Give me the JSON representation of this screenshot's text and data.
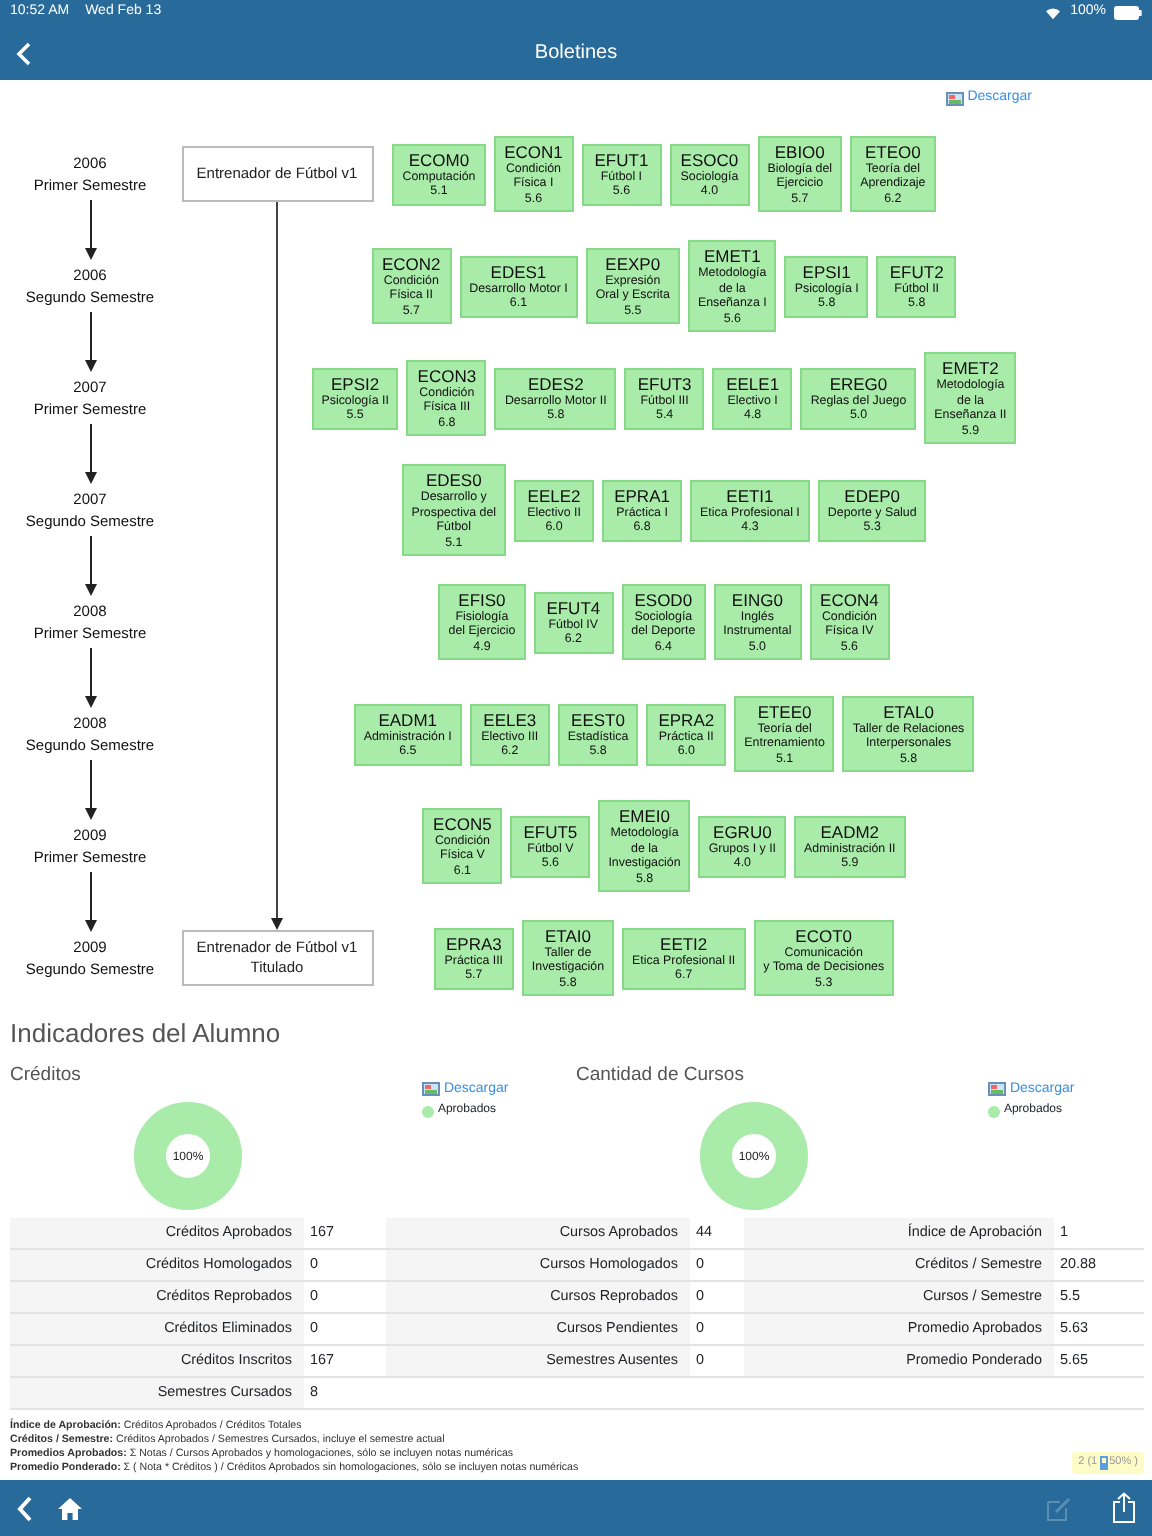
{
  "status_bar": {
    "time": "10:52 AM",
    "date": "Wed Feb 13",
    "battery": "100%"
  },
  "nav": {
    "title": "Boletines"
  },
  "download_link": "Descargar",
  "curriculum": {
    "start_node": "Entrenador de Fútbol v1",
    "end_node": "Entrenador de Fútbol v1\nTitulado",
    "semesters": [
      {
        "label": "2006\nPrimer Semestre",
        "courses": [
          {
            "code": "ECOM0",
            "name": "Computación",
            "grade": "5.1"
          },
          {
            "code": "ECON1",
            "name": "Condición\nFísica I",
            "grade": "5.6"
          },
          {
            "code": "EFUT1",
            "name": "Fútbol I",
            "grade": "5.6"
          },
          {
            "code": "ESOC0",
            "name": "Sociología",
            "grade": "4.0"
          },
          {
            "code": "EBIO0",
            "name": "Biología del\nEjercicio",
            "grade": "5.7"
          },
          {
            "code": "ETEO0",
            "name": "Teoría del\nAprendizaje",
            "grade": "6.2"
          }
        ]
      },
      {
        "label": "2006\nSegundo Semestre",
        "courses": [
          {
            "code": "ECON2",
            "name": "Condición\nFísica II",
            "grade": "5.7"
          },
          {
            "code": "EDES1",
            "name": "Desarrollo Motor I",
            "grade": "6.1"
          },
          {
            "code": "EEXP0",
            "name": "Expresión\nOral y Escrita",
            "grade": "5.5"
          },
          {
            "code": "EMET1",
            "name": "Metodología\nde la\nEnseñanza I",
            "grade": "5.6"
          },
          {
            "code": "EPSI1",
            "name": "Psicología I",
            "grade": "5.8"
          },
          {
            "code": "EFUT2",
            "name": "Fútbol II",
            "grade": "5.8"
          }
        ]
      },
      {
        "label": "2007\nPrimer Semestre",
        "courses": [
          {
            "code": "EPSI2",
            "name": "Psicología II",
            "grade": "5.5"
          },
          {
            "code": "ECON3",
            "name": "Condición\nFísica III",
            "grade": "6.8"
          },
          {
            "code": "EDES2",
            "name": "Desarrollo Motor II",
            "grade": "5.8"
          },
          {
            "code": "EFUT3",
            "name": "Fútbol III",
            "grade": "5.4"
          },
          {
            "code": "EELE1",
            "name": "Electivo I",
            "grade": "4.8"
          },
          {
            "code": "EREG0",
            "name": "Reglas del Juego",
            "grade": "5.0"
          },
          {
            "code": "EMET2",
            "name": "Metodología\nde la\nEnseñanza II",
            "grade": "5.9"
          }
        ]
      },
      {
        "label": "2007\nSegundo Semestre",
        "courses": [
          {
            "code": "EDES0",
            "name": "Desarrollo y\nProspectiva del\nFútbol",
            "grade": "5.1"
          },
          {
            "code": "EELE2",
            "name": "Electivo II",
            "grade": "6.0"
          },
          {
            "code": "EPRA1",
            "name": "Práctica I",
            "grade": "6.8"
          },
          {
            "code": "EETI1",
            "name": "Etica Profesional I",
            "grade": "4.3"
          },
          {
            "code": "EDEP0",
            "name": "Deporte y Salud",
            "grade": "5.3"
          }
        ]
      },
      {
        "label": "2008\nPrimer Semestre",
        "courses": [
          {
            "code": "EFIS0",
            "name": "Fisiología\ndel Ejercicio",
            "grade": "4.9"
          },
          {
            "code": "EFUT4",
            "name": "Fútbol IV",
            "grade": "6.2"
          },
          {
            "code": "ESOD0",
            "name": "Sociología\ndel Deporte",
            "grade": "6.4"
          },
          {
            "code": "EING0",
            "name": "Inglés\nInstrumental",
            "grade": "5.0"
          },
          {
            "code": "ECON4",
            "name": "Condición\nFísica IV",
            "grade": "5.6"
          }
        ]
      },
      {
        "label": "2008\nSegundo Semestre",
        "courses": [
          {
            "code": "EADM1",
            "name": "Administración I",
            "grade": "6.5"
          },
          {
            "code": "EELE3",
            "name": "Electivo III",
            "grade": "6.2"
          },
          {
            "code": "EEST0",
            "name": "Estadística",
            "grade": "5.8"
          },
          {
            "code": "EPRA2",
            "name": "Práctica II",
            "grade": "6.0"
          },
          {
            "code": "ETEE0",
            "name": "Teoría del\nEntrenamiento",
            "grade": "5.1"
          },
          {
            "code": "ETAL0",
            "name": "Taller de Relaciones\nInterpersonales",
            "grade": "5.8"
          }
        ]
      },
      {
        "label": "2009\nPrimer Semestre",
        "courses": [
          {
            "code": "ECON5",
            "name": "Condición\nFísica V",
            "grade": "6.1"
          },
          {
            "code": "EFUT5",
            "name": "Fútbol V",
            "grade": "5.6"
          },
          {
            "code": "EMEI0",
            "name": "Metodología\nde la\nInvestigación",
            "grade": "5.8"
          },
          {
            "code": "EGRU0",
            "name": "Grupos I y II",
            "grade": "4.0"
          },
          {
            "code": "EADM2",
            "name": "Administración II",
            "grade": "5.9"
          }
        ]
      },
      {
        "label": "2009\nSegundo Semestre",
        "courses": [
          {
            "code": "EPRA3",
            "name": "Práctica III",
            "grade": "5.7"
          },
          {
            "code": "ETAI0",
            "name": "Taller de\nInvestigación",
            "grade": "5.8"
          },
          {
            "code": "EETI2",
            "name": "Etica Profesional II",
            "grade": "6.7"
          },
          {
            "code": "ECOT0",
            "name": "Comunicación\ny Toma de Decisiones",
            "grade": "5.3"
          }
        ]
      }
    ]
  },
  "indicators": {
    "title": "Indicadores del Alumno",
    "charts": [
      {
        "title": "Créditos",
        "download": "Descargar",
        "legend": "Aprobados",
        "center_label": "100%"
      },
      {
        "title": "Cantidad de Cursos",
        "download": "Descargar",
        "legend": "Aprobados",
        "center_label": "100%"
      }
    ],
    "table": {
      "rows": [
        [
          {
            "label": "Créditos Aprobados",
            "value": "167"
          },
          {
            "label": "Cursos Aprobados",
            "value": "44"
          },
          {
            "label": "Índice de Aprobación",
            "value": "1"
          }
        ],
        [
          {
            "label": "Créditos Homologados",
            "value": "0"
          },
          {
            "label": "Cursos Homologados",
            "value": "0"
          },
          {
            "label": "Créditos / Semestre",
            "value": "20.88"
          }
        ],
        [
          {
            "label": "Créditos Reprobados",
            "value": "0"
          },
          {
            "label": "Cursos Reprobados",
            "value": "0"
          },
          {
            "label": "Cursos / Semestre",
            "value": "5.5"
          }
        ],
        [
          {
            "label": "Créditos Eliminados",
            "value": "0"
          },
          {
            "label": "Cursos Pendientes",
            "value": "0"
          },
          {
            "label": "Promedio Aprobados",
            "value": "5.63"
          }
        ],
        [
          {
            "label": "Créditos Inscritos",
            "value": "167"
          },
          {
            "label": "Semestres Ausentes",
            "value": "0"
          },
          {
            "label": "Promedio Ponderado",
            "value": "5.65"
          }
        ],
        [
          {
            "label": "Semestres Cursados",
            "value": "8"
          }
        ]
      ]
    },
    "notes": [
      "**Índice de Aprobación:**  Créditos Aprobados / Créditos Totales",
      "**Créditos / Semestre:**  Créditos Aprobados / Semestres Cursados, incluye el semestre actual",
      "**Promedios Aprobados:**  Σ Notas / Cursos Aprobados y homologaciones, sólo se incluyen notas numéricas",
      "**Promedio Ponderado:**  Σ ( Nota * Créditos ) / Créditos Aprobados sin homologaciones, sólo se incluyen notas numéricas"
    ]
  },
  "badge": {
    "count": "2 (1",
    "percent": "50% )"
  },
  "toolbar": {
    "edit_disabled": true
  }
}
